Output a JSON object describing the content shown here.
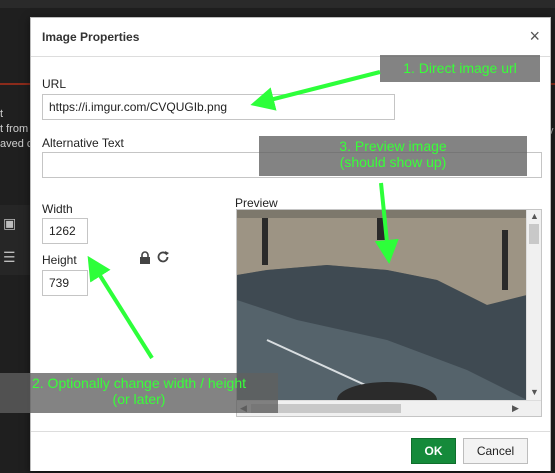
{
  "background": {
    "line1": "t",
    "line2": "t from",
    "line3": "aved c",
    "right_char": "v"
  },
  "dialog": {
    "title": "Image Properties",
    "close_glyph": "×"
  },
  "form": {
    "url_label": "URL",
    "url_value": "https://i.imgur.com/CVQUGIb.png",
    "alt_label": "Alternative Text",
    "alt_value": "",
    "width_label": "Width",
    "width_value": "1262",
    "height_label": "Height",
    "height_value": "739",
    "preview_label": "Preview"
  },
  "buttons": {
    "ok": "OK",
    "cancel": "Cancel"
  },
  "annotations": {
    "note1": "1. Direct image url",
    "note2_line1": "2. Optionally change width / height",
    "note2_line2": "(or later)",
    "note3_line1": "3. Preview image",
    "note3_line2": "(should show up)"
  },
  "colors": {
    "ok_button": "#158a3a",
    "annotation_text": "#38ff38",
    "arrow": "#2dff3a"
  },
  "icons": {
    "lock": "lock-icon",
    "reset": "refresh-icon",
    "close": "close-icon"
  }
}
